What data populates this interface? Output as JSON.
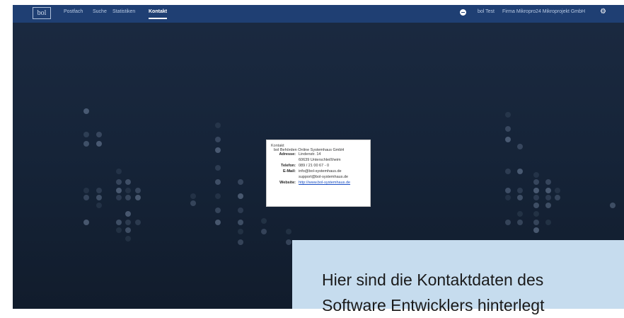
{
  "navbar": {
    "logo": "bol",
    "items": [
      {
        "label": "Postfach"
      },
      {
        "label": "Suche"
      },
      {
        "label": "Statistiken"
      },
      {
        "label": "Kontakt",
        "active": true
      }
    ],
    "user": "bol Test",
    "company": "Firma Mikropro24 Mikroprojekt GmbH"
  },
  "contact": {
    "heading": "Kontakt",
    "company": "bol Behörden Online Systemhaus GmbH",
    "rows": [
      {
        "label": "Adresse:",
        "lines": [
          "Lindenstr. 14",
          "60639 Unterschleißheim"
        ]
      },
      {
        "label": "Telefon:",
        "lines": [
          "089 / 21 00 67 - 0"
        ]
      },
      {
        "label": "E-Mail:",
        "lines": [
          "info@bol-systemhaus.de",
          "support@bol-systemhaus.de"
        ]
      },
      {
        "label": "Website:",
        "lines": [
          "http://www.bol-systemhaus.de"
        ],
        "link": true
      }
    ]
  },
  "callout": {
    "line1": "Hier sind die Kontaktdaten des",
    "line2": "Software Entwicklers hinterlegt"
  },
  "colors": {
    "navbar": "#1f3f73",
    "background": "#152337",
    "callout": "#c6dcee",
    "link": "#1a4fc4"
  }
}
